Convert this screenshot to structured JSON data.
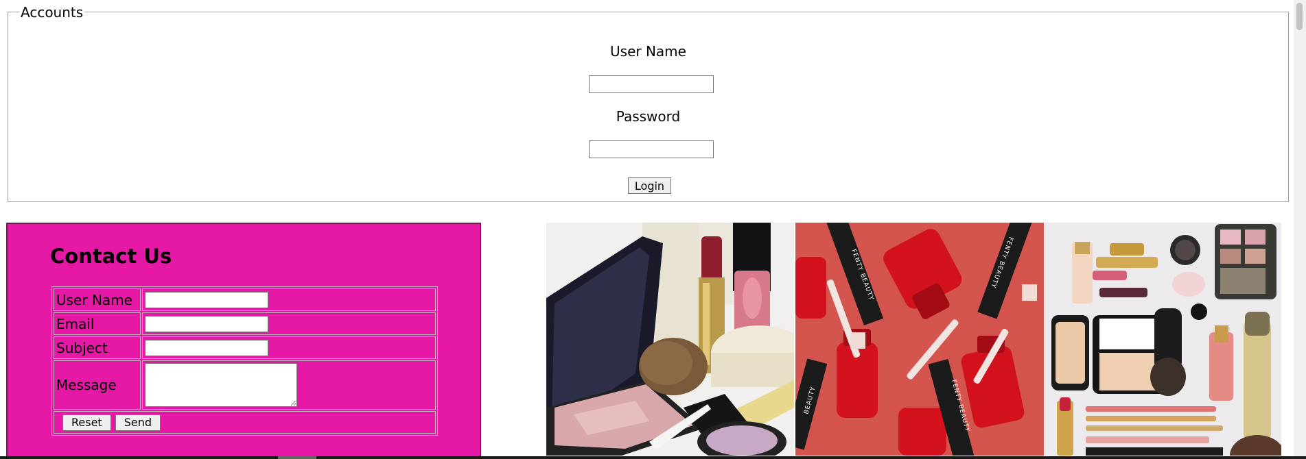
{
  "accounts": {
    "legend": "Accounts",
    "username_label": "User Name",
    "username_value": "",
    "password_label": "Password",
    "password_value": "",
    "login_label": "Login"
  },
  "contact": {
    "title": "Contact Us",
    "fields": {
      "username_label": "User Name",
      "email_label": "Email",
      "subject_label": "Subject",
      "message_label": "Message"
    },
    "reset_label": "Reset",
    "send_label": "Send",
    "background": "#e619a6"
  },
  "images": [
    {
      "name": "compact-and-brush-image"
    },
    {
      "name": "red-nail-polish-image",
      "brand_text": "FENTY BEAUTY"
    },
    {
      "name": "makeup-flatlay-image"
    }
  ]
}
